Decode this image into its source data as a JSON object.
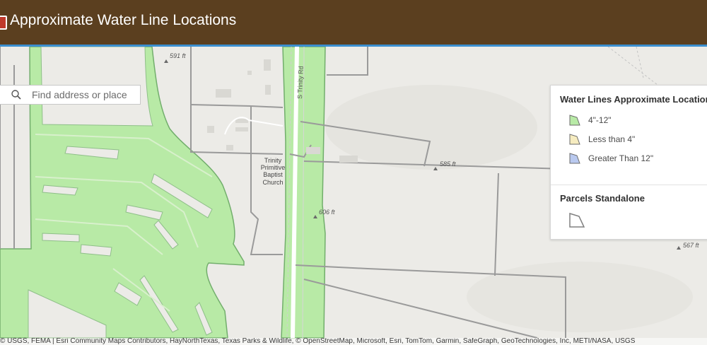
{
  "header": {
    "title": "Approximate Water Line Locations"
  },
  "search": {
    "placeholder": "Find address or place"
  },
  "map": {
    "road_label": "S Trinity Rd",
    "elevations": [
      "591 ft",
      "585 ft",
      "606 ft",
      "567 ft"
    ],
    "poi_label_lines": [
      "Trinity",
      "Primitive",
      "Baptist",
      "Church"
    ]
  },
  "legend": {
    "layers": [
      {
        "title": "Water Lines Approximate Locations",
        "items": [
          {
            "label": "4\"-12\"",
            "color": "#b8eaa6"
          },
          {
            "label": "Less than 4\"",
            "color": "#f6ecc0"
          },
          {
            "label": "Greater Than 12\"",
            "color": "#b9c9ef"
          }
        ]
      },
      {
        "title": "Parcels Standalone",
        "items": [
          {
            "label": "",
            "color": "#ffffff"
          }
        ]
      }
    ]
  },
  "attribution": "© USGS, FEMA | Esri Community Maps Contributors, HayNorthTexas, Texas Parks & Wildlife, © OpenStreetMap, Microsoft, Esri, TomTom, Garmin, SafeGraph, GeoTechnologies, Inc, METI/NASA, USGS",
  "colors": {
    "header_bg": "#5b3f1f",
    "header_accent": "#3b8fd0",
    "water_fill": "#b8eaa6",
    "water_stroke": "#6fb06a",
    "parcel_stroke": "#9a9a9a",
    "basemap": "#ecebe7"
  }
}
